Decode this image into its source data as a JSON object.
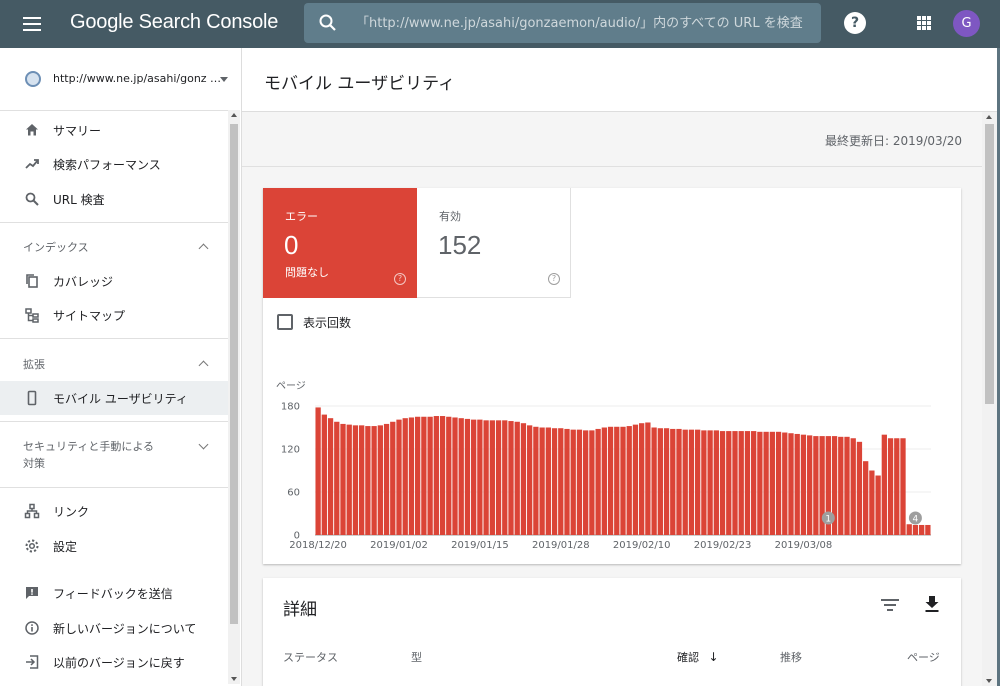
{
  "app": {
    "title": "Google Search Console",
    "search_placeholder": "「http://www.ne.jp/asahi/gonzaemon/audio/」内のすべての URL を検査",
    "avatar_letter": "G",
    "help_glyph": "?"
  },
  "sidebar": {
    "property": "http://www.ne.jp/asahi/gonz …",
    "items": [
      {
        "label": "サマリー"
      },
      {
        "label": "検索パフォーマンス"
      },
      {
        "label": "URL 検査"
      }
    ],
    "index_section": {
      "title": "インデックス",
      "items": [
        {
          "label": "カバレッジ"
        },
        {
          "label": "サイトマップ"
        }
      ]
    },
    "enhance_section": {
      "title": "拡張",
      "items": [
        {
          "label": "モバイル ユーザビリティ"
        }
      ]
    },
    "security_section": {
      "title_line1": "セキュリティと手動による",
      "title_line2": "対策"
    },
    "bottom_items": [
      {
        "label": "リンク"
      },
      {
        "label": "設定"
      }
    ],
    "footer_items": [
      {
        "label": "フィードバックを送信"
      },
      {
        "label": "新しいバージョンについて"
      },
      {
        "label": "以前のバージョンに戻す"
      }
    ]
  },
  "page": {
    "title": "モバイル ユーザビリティ",
    "last_updated": "最終更新日: 2019/03/20"
  },
  "summary": {
    "error": {
      "label": "エラー",
      "count": "0",
      "sub": "問題なし",
      "help": "?"
    },
    "valid": {
      "label": "有効",
      "count": "152",
      "help": "?"
    },
    "impressions_label": "表示回数"
  },
  "chart_data": {
    "type": "bar",
    "ylabel": "ページ",
    "ylim": [
      0,
      180
    ],
    "yticks": [
      "0",
      "60",
      "120",
      "180"
    ],
    "x_tick_labels": [
      "2018/12/20",
      "2019/01/02",
      "2019/01/15",
      "2019/01/28",
      "2019/02/10",
      "2019/02/23",
      "2019/03/08"
    ],
    "annotations": [
      {
        "label": "1",
        "index": 82
      },
      {
        "label": "4",
        "index": 96
      }
    ],
    "color": "#db4437",
    "values": [
      178,
      168,
      163,
      158,
      155,
      154,
      153,
      153,
      152,
      152,
      153,
      155,
      158,
      161,
      163,
      164,
      165,
      165,
      165,
      166,
      166,
      165,
      164,
      163,
      162,
      161,
      161,
      160,
      160,
      160,
      160,
      159,
      158,
      156,
      153,
      151,
      150,
      150,
      149,
      149,
      148,
      147,
      147,
      146,
      146,
      148,
      150,
      151,
      151,
      151,
      152,
      154,
      156,
      157,
      150,
      149,
      149,
      148,
      148,
      147,
      147,
      147,
      146,
      146,
      146,
      145,
      145,
      145,
      145,
      145,
      145,
      144,
      144,
      144,
      144,
      143,
      142,
      141,
      140,
      139,
      138,
      138,
      138,
      138,
      137,
      137,
      135,
      130,
      103,
      90,
      83,
      140,
      135,
      135,
      135,
      15,
      14,
      14,
      14
    ]
  },
  "details": {
    "title": "詳細",
    "columns": [
      {
        "label": "ステータス"
      },
      {
        "label": "型"
      },
      {
        "label": "確認"
      },
      {
        "label": "推移"
      },
      {
        "label": "ページ"
      }
    ],
    "sort_arrow": "↓"
  }
}
